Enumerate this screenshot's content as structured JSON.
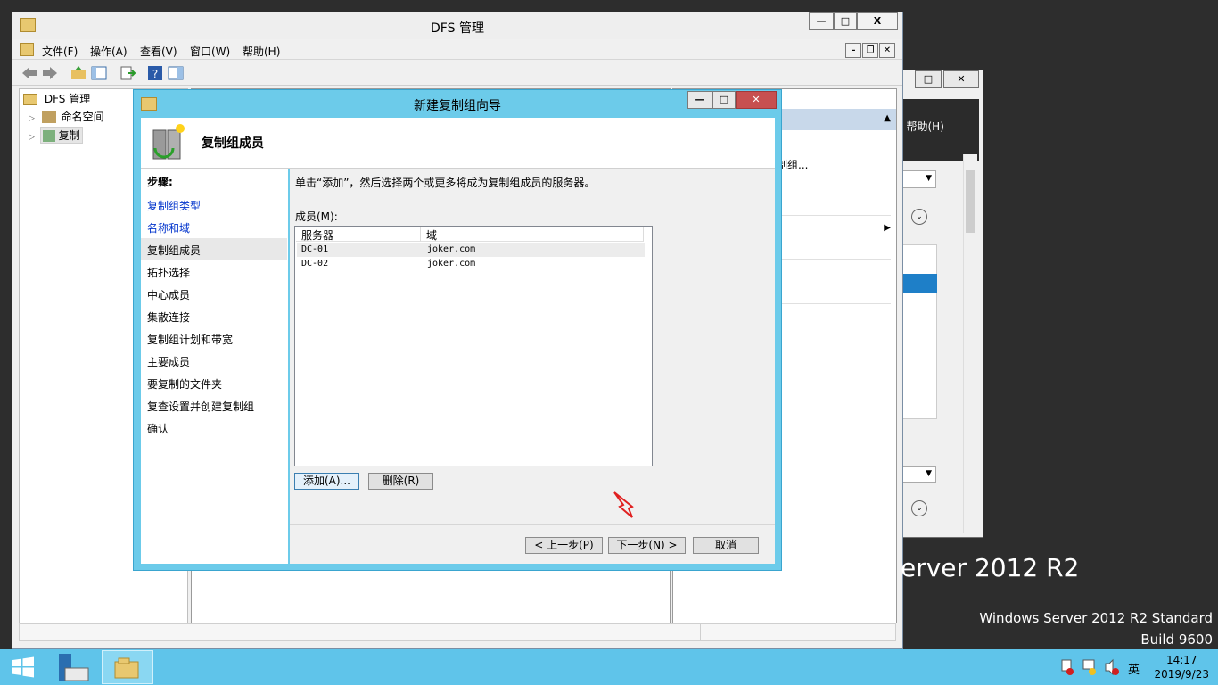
{
  "main_window": {
    "title": "DFS 管理",
    "caption_buttons": {
      "minimize": "—",
      "maximize": "□",
      "close": "X"
    },
    "menu": [
      "文件(F)",
      "操作(A)",
      "查看(V)",
      "窗口(W)",
      "帮助(H)"
    ],
    "tree": {
      "root": "DFS 管理",
      "children": [
        "命名空间",
        "复制"
      ]
    }
  },
  "bg_window": {
    "menu_help": ")  帮助(H)",
    "partial_text": "制组..."
  },
  "wizard": {
    "title": "新建复制组向导",
    "header": "复制组成员",
    "steps_heading": "步骤:",
    "steps": [
      {
        "label": "复制组类型",
        "state": "link"
      },
      {
        "label": "名称和域",
        "state": "link"
      },
      {
        "label": "复制组成员",
        "state": "current"
      },
      {
        "label": "拓扑选择",
        "state": "pending"
      },
      {
        "label": "中心成员",
        "state": "pending"
      },
      {
        "label": "集散连接",
        "state": "pending"
      },
      {
        "label": "复制组计划和带宽",
        "state": "pending"
      },
      {
        "label": "主要成员",
        "state": "pending"
      },
      {
        "label": "要复制的文件夹",
        "state": "pending"
      },
      {
        "label": "复查设置并创建复制组",
        "state": "pending"
      },
      {
        "label": "确认",
        "state": "pending"
      }
    ],
    "description": "单击“添加”，然后选择两个或更多将成为复制组成员的服务器。",
    "members_label": "成员(M):",
    "columns": [
      "服务器",
      "域"
    ],
    "members": [
      {
        "server": "DC-01",
        "domain": "joker.com"
      },
      {
        "server": "DC-02",
        "domain": "joker.com"
      }
    ],
    "buttons": {
      "add": "添加(A)...",
      "remove": "删除(R)",
      "back": "< 上一步(P)",
      "next": "下一步(N) >",
      "cancel": "取消"
    }
  },
  "desktop": {
    "brand_large": "erver 2012 R2",
    "edition": "Windows Server 2012 R2 Standard",
    "build": "Build 9600"
  },
  "taskbar": {
    "ime": "英",
    "time": "14:17",
    "date": "2019/9/23"
  },
  "colors": {
    "taskbar": "#5fc4ea",
    "wizard_frame": "#6ccbea",
    "link": "#0033cc",
    "close_red": "#c75050"
  }
}
